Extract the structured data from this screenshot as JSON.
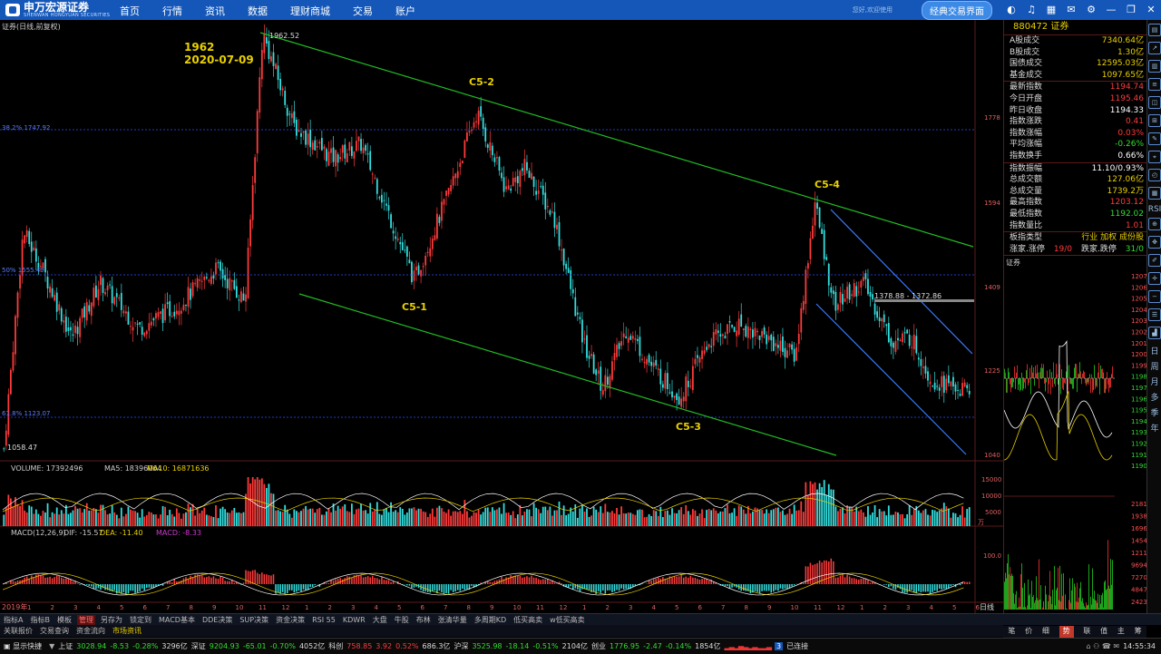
{
  "header": {
    "logo_text": "申万宏源证券",
    "logo_sub": "SHENWAN HONGYUAN SECURITIES",
    "nav": [
      "首页",
      "行情",
      "资讯",
      "数据",
      "理财商城",
      "交易",
      "账户"
    ],
    "greeting": "您好,欢迎使用",
    "classic_btn": "经典交易界面",
    "icons": [
      "theme-icon",
      "headset-icon",
      "grid-icon",
      "mail-icon",
      "settings-icon",
      "minimize-icon",
      "restore-icon",
      "close-icon"
    ]
  },
  "chart": {
    "title_left": "证券(日线,前复权)",
    "peak_label_1": "1962",
    "peak_label_2": "2020-07-09",
    "peak_value": "1962.52",
    "low_value": "1058.47",
    "fib_382": "38.2% 1747.92",
    "fib_50": "50% 1555.49",
    "fib_618": "61.8% 1123.07",
    "range_label": "1378.88 - 1372.86",
    "wave_labels": {
      "c51": "C5-1",
      "c52": "C5-2",
      "c53": "C5-3",
      "c54": "C5-4"
    },
    "price_ticks": [
      "1778",
      "1594",
      "1409",
      "1225",
      "1040"
    ],
    "volume_label": "VOLUME: 17392496",
    "ma5_label": "MA5: 18396064",
    "ma10_label": "MA10: 16871636",
    "volume_ticks": [
      "15000",
      "10000",
      "5000"
    ],
    "volume_unit": "万",
    "macd_label": "MACD(12,26,9)",
    "dif_label": "DIF: -15.57",
    "dea_label": "DEA: -11.40",
    "macd_val_label": "MACD: -8.33",
    "macd_tick": "100.0",
    "x_first_label": "2019年",
    "period_label": "日线",
    "colors": {
      "up": "#ff3b3b",
      "down": "#33e0e0",
      "trend": "#22bb22",
      "channel": "#3a7bff",
      "label": "#e8d000",
      "fib": "#2a4fff"
    }
  },
  "chart_data": {
    "type": "line",
    "title": "证券(日线,前复权)",
    "xlabel": "",
    "ylabel": "",
    "ylim": [
      1040,
      1962.52
    ],
    "points": [
      {
        "label": "2019年",
        "value": 1058.47
      },
      {
        "label": "1962 2020-07-09",
        "value": 1962.52
      },
      {
        "label": "C5-1",
        "value": 1425
      },
      {
        "label": "C5-2",
        "value": 1790
      },
      {
        "label": "C5-3",
        "value": 1170
      },
      {
        "label": "C5-4",
        "value": 1594
      },
      {
        "label": "最新",
        "value": 1194.74
      }
    ]
  },
  "tabs_bottom": [
    "指标A",
    "指标B",
    "模板",
    "管理",
    "另存为",
    "锁定到",
    "MACD基本",
    "DDE决策",
    "SUP决策",
    "资金决策",
    "RSI 55",
    "KDWR",
    "大盘",
    "牛股",
    "布林",
    "张清华量",
    "多周期KD",
    "低买高卖",
    "w低买高卖"
  ],
  "tabs_bottom_active": "管理",
  "tabs_bottom2": [
    "关联报价",
    "交易查询",
    "资金流向",
    "市场资讯"
  ],
  "tabs_bottom2_active": "市场资讯",
  "panel": {
    "code": "880472 证券",
    "rows": [
      {
        "k": "A股成交",
        "v": "7340.64",
        "u": "亿",
        "c": "#e8d000"
      },
      {
        "k": "B股成交",
        "v": "1.30",
        "u": "亿",
        "c": "#e8d000"
      },
      {
        "k": "国债成交",
        "v": "12595.03",
        "u": "亿",
        "c": "#e8d000"
      },
      {
        "k": "基金成交",
        "v": "1097.65",
        "u": "亿",
        "c": "#e8d000"
      },
      {
        "k": "最新指数",
        "v": "1194.74",
        "u": "",
        "c": "#ff3b3b"
      },
      {
        "k": "今日开盘",
        "v": "1195.46",
        "u": "",
        "c": "#ff3b3b"
      },
      {
        "k": "昨日收盘",
        "v": "1194.33",
        "u": "",
        "c": "#ffffff"
      },
      {
        "k": "指数涨跌",
        "v": "0.41",
        "u": "",
        "c": "#ff3b3b"
      },
      {
        "k": "指数涨幅",
        "v": "0.03%",
        "u": "",
        "c": "#ff3b3b"
      },
      {
        "k": "平均涨幅",
        "v": "-0.26%",
        "u": "",
        "c": "#33dd33"
      },
      {
        "k": "指数换手",
        "v": "0.66%",
        "u": "",
        "c": "#ffffff"
      },
      {
        "k": "指数振幅",
        "v": "11.10/0.93%",
        "u": "",
        "c": "#ffffff"
      },
      {
        "k": "总成交额",
        "v": "127.06",
        "u": "亿",
        "c": "#e8d000"
      },
      {
        "k": "总成交量",
        "v": "1739.2",
        "u": "万",
        "c": "#e8d000"
      },
      {
        "k": "最高指数",
        "v": "1203.12",
        "u": "",
        "c": "#ff3b3b"
      },
      {
        "k": "最低指数",
        "v": "1192.02",
        "u": "",
        "c": "#33dd33"
      },
      {
        "k": "指数量比",
        "v": "1.01",
        "u": "",
        "c": "#ff3b3b"
      }
    ],
    "type_k": "板指类型",
    "type_v": "行业 加权 成份股",
    "zt_k": "涨家.涨停",
    "zt_v": "19/0",
    "dt_k": "跌家.跌停",
    "dt_v": "31/0",
    "mini_title": "证券",
    "mini_ticks": [
      "1207",
      "1206",
      "1205",
      "1204",
      "1203",
      "1202",
      "1201",
      "1200",
      "1199",
      "1198",
      "1197",
      "1196",
      "1195",
      "1194",
      "1193",
      "1192",
      "1191",
      "1190"
    ],
    "mini_vol_ticks": [
      "21811",
      "19387",
      "16964",
      "14541",
      "12117",
      "9694",
      "7270",
      "4847",
      "2423"
    ]
  },
  "right_tabs": [
    "笔",
    "价",
    "细",
    "势",
    "联",
    "值",
    "主",
    "筹"
  ],
  "right_tabs_active": "势",
  "sidebar": [
    "RSI",
    "日",
    "周",
    "月",
    "多",
    "季",
    "年"
  ],
  "status": {
    "show_fast": "显示快捷",
    "sh_name": "上证",
    "sh_val": "3028.94",
    "sh_chg": "-8.53",
    "sh_pct": "-0.28%",
    "sh_amt": "3296亿",
    "sz_name": "深证",
    "sz_val": "9204.93",
    "sz_chg": "-65.01",
    "sz_pct": "-0.70%",
    "sz_amt": "4052亿",
    "kc_name": "科创",
    "kc_val": "758.85",
    "kc_chg": "3.92",
    "kc_pct": "0.52%",
    "kc_amt": "686.3亿",
    "hs_name": "沪深",
    "hs_val": "3525.98",
    "hs_chg": "-18.14",
    "hs_pct": "-0.51%",
    "hs_amt": "2104亿",
    "cy_name": "创业",
    "cy_val": "1776.95",
    "cy_chg": "-2.47",
    "cy_pct": "-0.14%",
    "cy_amt": "1854亿",
    "conn_count": "3",
    "conn": "已连接",
    "time": "14:55:34"
  }
}
